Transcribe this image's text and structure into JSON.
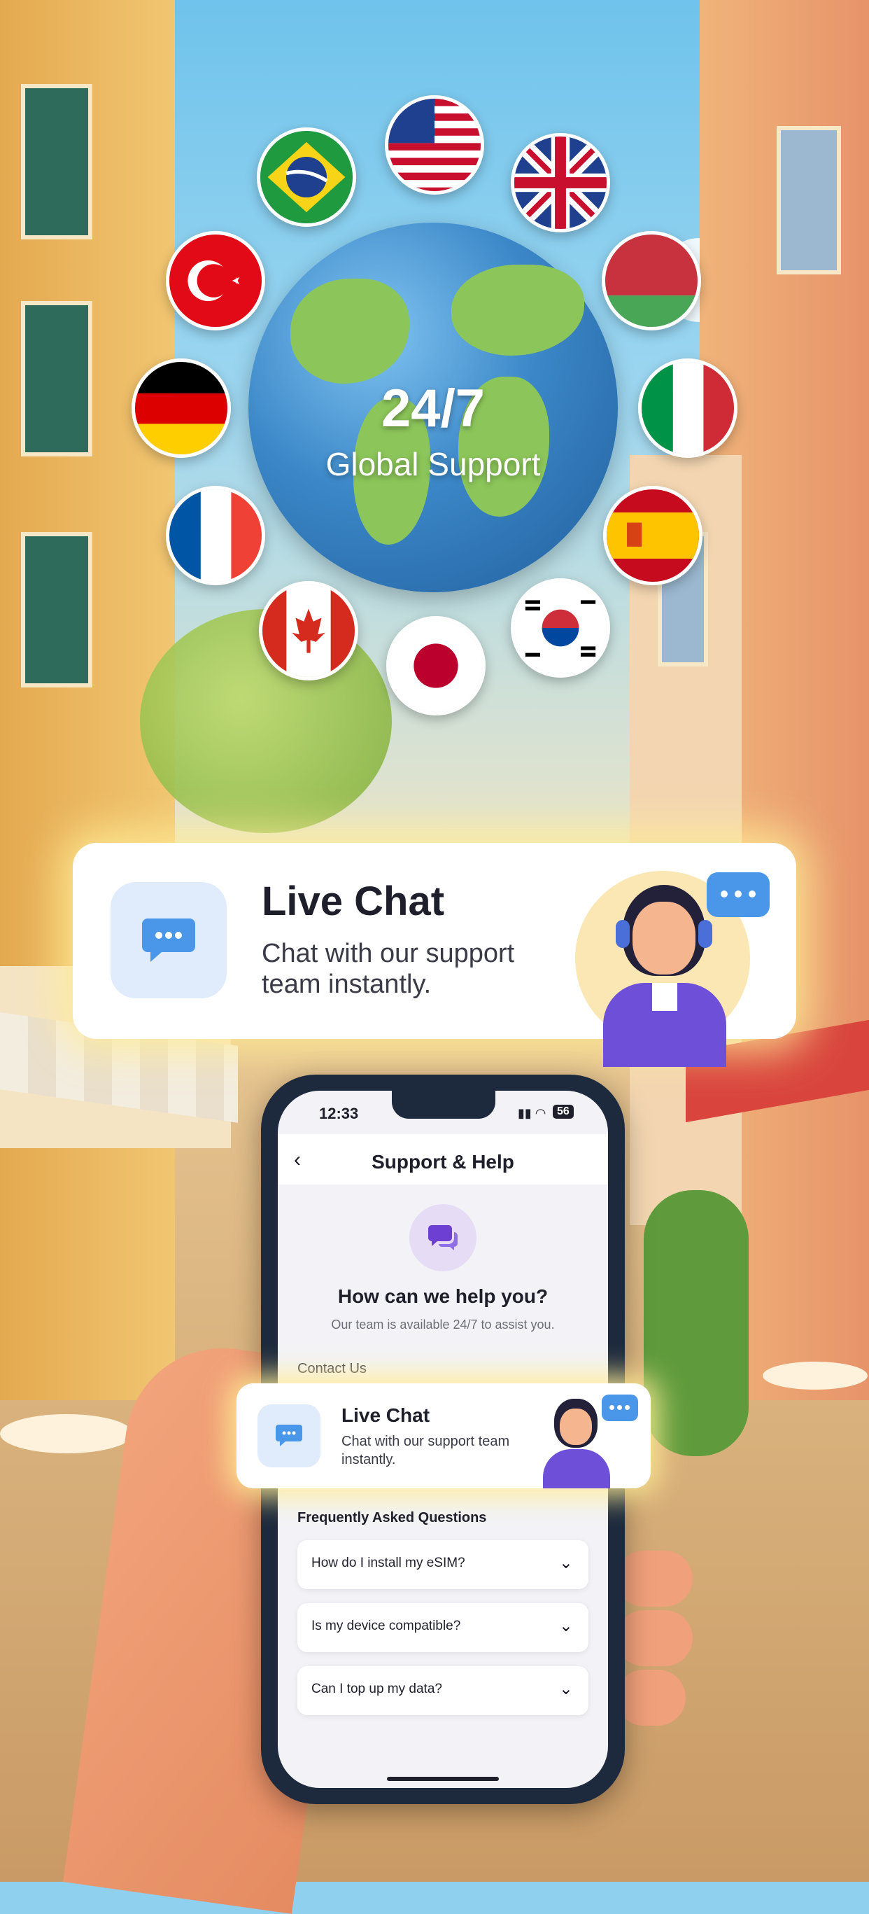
{
  "hero": {
    "headline": "24/7",
    "subheadline": "Global Support"
  },
  "flags": [
    {
      "country": "usa",
      "icon": "usa-flag-icon"
    },
    {
      "country": "uk",
      "icon": "uk-flag-icon"
    },
    {
      "country": "brazil",
      "icon": "brazil-flag-icon"
    },
    {
      "country": "turkey",
      "icon": "turkey-flag-icon"
    },
    {
      "country": "belarus",
      "icon": "belarus-flag-icon"
    },
    {
      "country": "germany",
      "icon": "germany-flag-icon"
    },
    {
      "country": "italy",
      "icon": "italy-flag-icon"
    },
    {
      "country": "france",
      "icon": "france-flag-icon"
    },
    {
      "country": "spain",
      "icon": "spain-flag-icon"
    },
    {
      "country": "canada",
      "icon": "canada-flag-icon"
    },
    {
      "country": "japan",
      "icon": "japan-flag-icon"
    },
    {
      "country": "south-korea",
      "icon": "south-korea-flag-icon"
    }
  ],
  "live_chat_card": {
    "title": "Live Chat",
    "description": "Chat with our support team instantly.",
    "icon": "chat-bubble-icon"
  },
  "phone": {
    "status": {
      "time": "12:33",
      "battery": "56"
    },
    "header": {
      "title": "Support & Help",
      "back_icon": "back-arrow-icon"
    },
    "help": {
      "title": "How can we help you?",
      "subtitle": "Our team is available 24/7 to assist you."
    },
    "contact_section": "Contact Us",
    "live_chat": {
      "title": "Live Chat",
      "description": "Chat with our support team instantly."
    },
    "faq_section": "Frequently Asked Questions",
    "faqs": [
      "How do I install my eSIM?",
      "Is my device compatible?",
      "Can I top up my data?"
    ]
  },
  "colors": {
    "accent_blue": "#4a97ea",
    "accent_purple": "#6d3fd3",
    "card_glow": "#ffec96"
  }
}
